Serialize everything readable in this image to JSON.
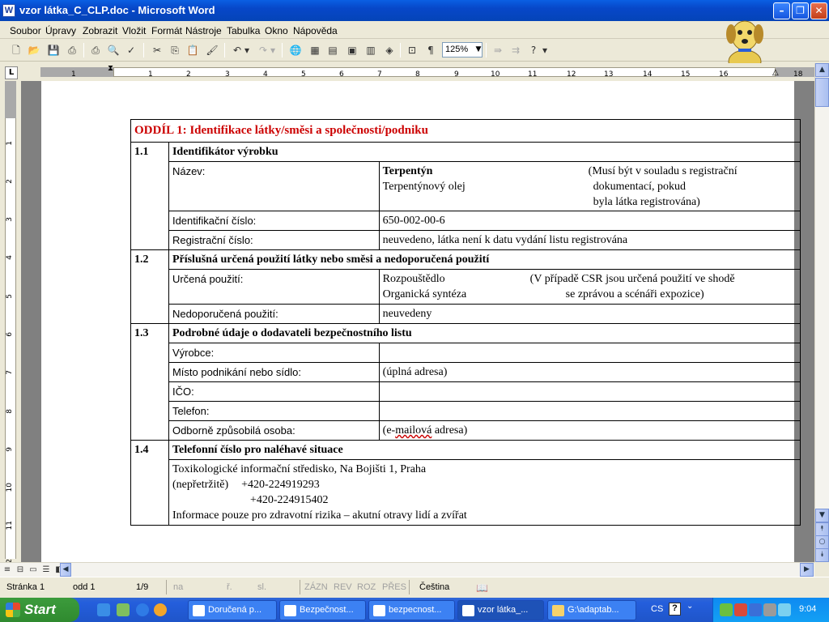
{
  "window": {
    "title": "vzor látka_C_CLP.doc - Microsoft Word",
    "app_icon": "W"
  },
  "menu": [
    "Soubor",
    "Úpravy",
    "Zobrazit",
    "Vložit",
    "Formát",
    "Nástroje",
    "Tabulka",
    "Okno",
    "Nápověda"
  ],
  "toolbar": {
    "zoom": "125%"
  },
  "ruler": {
    "h_ticks": [
      "1",
      "1",
      "2",
      "3",
      "4",
      "5",
      "6",
      "7",
      "8",
      "9",
      "10",
      "11",
      "12",
      "13",
      "14",
      "15",
      "16",
      "18"
    ],
    "v_ticks": [
      "1",
      "2",
      "3",
      "4",
      "5",
      "6",
      "7",
      "8",
      "9",
      "10",
      "11",
      "12"
    ],
    "corner": "L"
  },
  "doc": {
    "section_title": "ODDÍL 1:  Identifikace látky/směsi a společnosti/podniku",
    "s11": {
      "num": "1.1",
      "title": "Identifikátor výrobku",
      "name_label": "Název:",
      "name_value": "Terpentýn",
      "name_alt": "Terpentýnový olej",
      "name_note": [
        "(Musí být v souladu s registrační",
        "dokumentací, pokud",
        "byla látka registrována)"
      ],
      "id_label": "Identifikační číslo:",
      "id_value": "650-002-00-6",
      "reg_label": "Registrační číslo:",
      "reg_value": "neuvedeno, látka není k datu vydání listu registrována"
    },
    "s12": {
      "num": "1.2",
      "title": "Příslušná určená použití látky nebo směsi a nedoporučená použití",
      "use_label": "Určená použití:",
      "use_1": "Rozpouštědlo",
      "use_2": "Organická syntéza",
      "use_note": [
        "(V případě CSR jsou určená použití ve shodě",
        "se zprávou a scénáři expozice)"
      ],
      "not_label": "Nedoporučená použití:",
      "not_value": "neuvedeny"
    },
    "s13": {
      "num": "1.3",
      "title": "Podrobné údaje o dodavateli bezpečnostního listu",
      "maker_label": "Výrobce:",
      "addr_label": "Místo podnikání nebo sídlo:",
      "addr_value": "(úplná adresa)",
      "ico_label": "IČO:",
      "phone_label": "Telefon:",
      "person_label": "Odborně způsobilá osoba:",
      "person_value_a": "(e-",
      "person_value_b": "mailová",
      "person_value_c": " adresa)"
    },
    "s14": {
      "num": "1.4",
      "title": "Telefonní číslo pro naléhavé situace",
      "l1": "Toxikologické informační středisko, Na Bojišti 1, Praha",
      "l2a": "(nepřetržitě)",
      "l2b": "+420-224919293",
      "l3": "+420-224915402",
      "l4": "Informace pouze pro zdravotní rizika – akutní otravy lidí a zvířat"
    }
  },
  "status": {
    "page": "Stránka  1",
    "section": "odd  1",
    "pages": "1/9",
    "at": "na",
    "line": "ř.",
    "col": "sl.",
    "rec": "ZÁZN",
    "rev": "REV",
    "ext": "ROZ",
    "ovr": "PŘES",
    "lang": "Čeština"
  },
  "taskbar": {
    "start": "Start",
    "tasks": [
      "Doručená p...",
      "Bezpečnost...",
      "bezpecnost...",
      "vzor látka_...",
      "G:\\adaptab..."
    ],
    "lang": "CS",
    "clock": "9:04"
  }
}
